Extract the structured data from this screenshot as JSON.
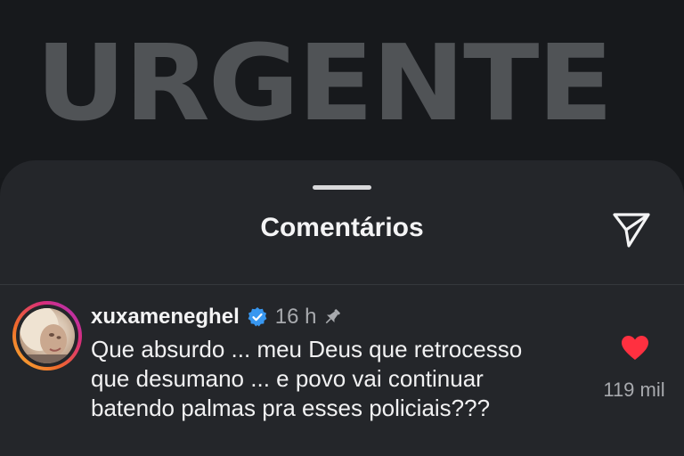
{
  "background": {
    "banner_text": "URGENTE"
  },
  "sheet": {
    "title": "Comentários",
    "share_icon": "paper-plane-icon"
  },
  "comment": {
    "username": "xuxameneghel",
    "verified_icon": "verified-badge-icon",
    "time": "16 h",
    "pin_icon": "pin-icon",
    "lines": [
      "Que absurdo ... meu Deus que retrocesso",
      "que desumano ... e povo vai continuar",
      "batendo palmas pra esses policiais???"
    ],
    "like_icon": "heart-icon",
    "like_count": "119 mil"
  },
  "colors": {
    "like": "#ff3040",
    "verified": "#3897f0",
    "sheet_bg": "#24262a"
  }
}
